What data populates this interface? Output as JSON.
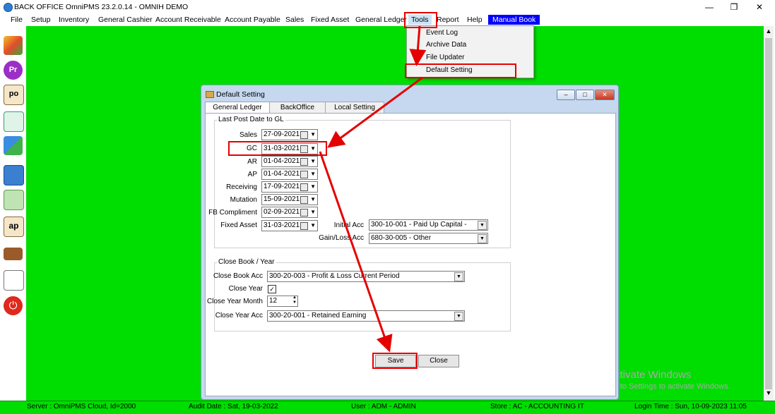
{
  "window": {
    "title": "BACK OFFICE OmniPMS 23.2.0.14 - OMNIH DEMO",
    "min_icon": "minimize-icon",
    "restore_icon": "restore-icon",
    "close_icon": "close-icon"
  },
  "menubar": {
    "items": [
      "File",
      "Setup",
      "Inventory",
      "General Cashier",
      "Account Receivable",
      "Account Payable",
      "Sales",
      "Fixed Asset",
      "General Ledger",
      "Tools",
      "Report",
      "Help",
      "Manual Book"
    ]
  },
  "tools_menu": {
    "items": [
      "Event Log",
      "Archive Data",
      "File Updater",
      "Default Setting"
    ]
  },
  "sidebar": {
    "icons": [
      "cubes-icon",
      "pr-icon",
      "po-icon",
      "shopping-bag-add-icon",
      "arrows-icon",
      "register-icon",
      "money-icon",
      "ap-icon",
      "books-icon",
      "report-chart-icon",
      "power-icon"
    ]
  },
  "dialog": {
    "title": "Default Setting",
    "tabs": [
      "General Ledger",
      "BackOffice",
      "Local Setting"
    ],
    "last_post_group": "Last Post Date to GL",
    "fields": [
      {
        "label": "Sales",
        "value": "27-09-2021"
      },
      {
        "label": "GC",
        "value": "31-03-2021"
      },
      {
        "label": "AR",
        "value": "01-04-2021"
      },
      {
        "label": "AP",
        "value": "01-04-2021"
      },
      {
        "label": "Receiving",
        "value": "17-09-2021"
      },
      {
        "label": "Mutation",
        "value": "15-09-2021"
      },
      {
        "label": "FB Compliment",
        "value": "02-09-2021"
      },
      {
        "label": "Fixed Asset",
        "value": "31-03-2021"
      }
    ],
    "initial_acc": {
      "label": "Initial Acc",
      "value": "300-10-001 - Paid Up Capital -"
    },
    "gain_loss_acc": {
      "label": "Gain/Loss Acc",
      "value": "680-30-005 - Other"
    },
    "close_group": "Close Book / Year",
    "close_book_acc": {
      "label": "Close Book Acc",
      "value": "300-20-003 - Profit & Loss Current Period"
    },
    "close_year": {
      "label": "Close Year",
      "checked": true
    },
    "close_year_month": {
      "label": "Close Year Month",
      "value": "12"
    },
    "close_year_acc": {
      "label": "Close Year Acc",
      "value": "300-20-001 - Retained Earning"
    },
    "save_label": "Save",
    "close_label": "Close"
  },
  "watermark": {
    "line1": "Activate Windows",
    "line2": "Go to Settings to activate Windows."
  },
  "statusbar": {
    "server": "Server : OmniPMS Cloud, Id=2000",
    "audit": "Audit Date : Sat, 19-03-2022",
    "user": "User : ADM - ADMIN",
    "store": "Store : AC - ACCOUNTING  IT",
    "login": "Login Time : Sun, 10-09-2023 11:05"
  },
  "annotation_color": "#e50000",
  "workspace_color": "#00dd00"
}
